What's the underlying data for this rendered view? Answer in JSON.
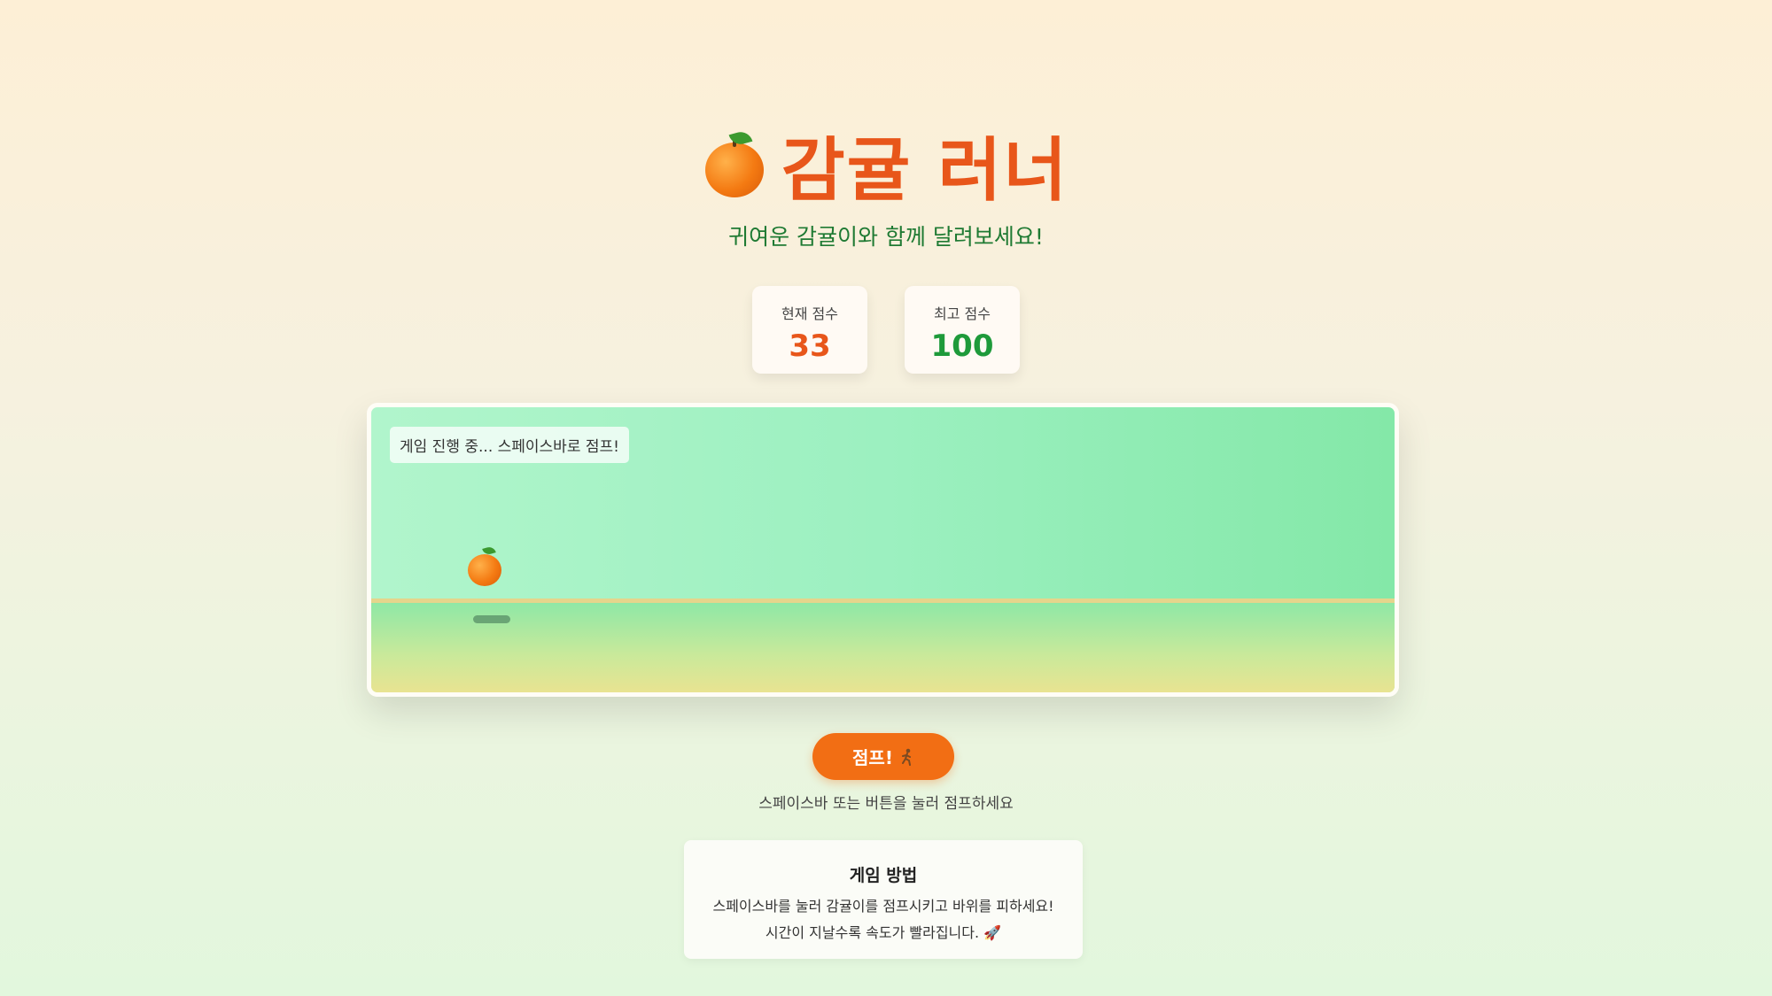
{
  "header": {
    "title_icon": "tangerine-icon",
    "title": "감귤 러너",
    "subtitle": "귀여운 감귤이와 함께 달려보세요!"
  },
  "scores": {
    "current_label": "현재 점수",
    "current_value": "33",
    "best_label": "최고 점수",
    "best_value": "100"
  },
  "game": {
    "status": "게임 진행 중... 스페이스바로 점프!",
    "player_icon": "tangerine-icon"
  },
  "controls": {
    "jump_label": "점프!",
    "jump_icon": "running-person-icon",
    "hint": "스페이스바 또는 버튼을 눌러 점프하세요"
  },
  "howto": {
    "title": "게임 방법",
    "line1": "스페이스바를 눌러 감귤이를 점프시키고 바위를 피하세요!",
    "line2": "시간이 지날수록 속도가 빨라집니다. 🚀"
  },
  "colors": {
    "accent": "#e8561a",
    "button": "#f26e14",
    "best": "#1e9a3a",
    "subtitle": "#1f7a33"
  }
}
